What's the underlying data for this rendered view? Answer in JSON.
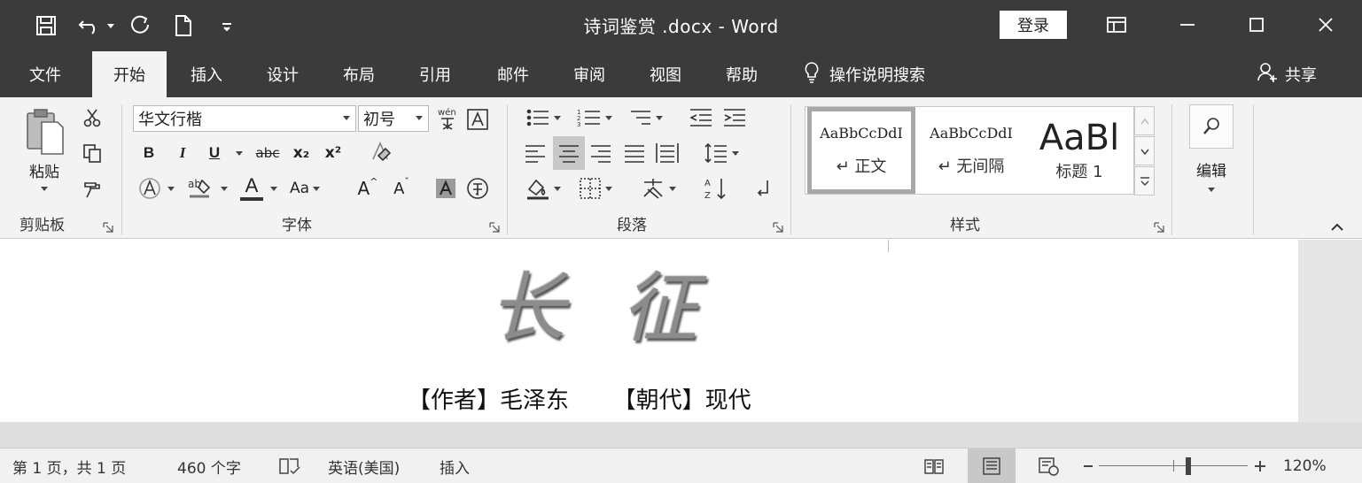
{
  "titlebar": {
    "title": "诗词鉴赏 .docx  -  Word",
    "login_label": "登录",
    "qat_icons": [
      "save-icon",
      "undo-icon",
      "redo-icon",
      "new-document-icon",
      "customize-qat-icon"
    ]
  },
  "tabs": [
    {
      "label": "文件",
      "active": false
    },
    {
      "label": "开始",
      "active": true
    },
    {
      "label": "插入",
      "active": false
    },
    {
      "label": "设计",
      "active": false
    },
    {
      "label": "布局",
      "active": false
    },
    {
      "label": "引用",
      "active": false
    },
    {
      "label": "邮件",
      "active": false
    },
    {
      "label": "审阅",
      "active": false
    },
    {
      "label": "视图",
      "active": false
    },
    {
      "label": "帮助",
      "active": false
    }
  ],
  "tell_me": "操作说明搜索",
  "share": "共享",
  "ribbon": {
    "clipboard": {
      "paste_label": "粘贴",
      "group_label": "剪贴板"
    },
    "font": {
      "font_name": "华文行楷",
      "font_size": "初号",
      "bold": "B",
      "italic": "I",
      "underline": "U",
      "strike": "abc",
      "subscript": "x₂",
      "superscript": "x²",
      "font_color": "A",
      "change_case": "Aa",
      "grow": "A",
      "shrink": "A",
      "group_label": "字体"
    },
    "paragraph": {
      "group_label": "段落"
    },
    "styles": {
      "items": [
        {
          "sample": "AaBbCcDdI",
          "name": "↵ 正文",
          "selected": true
        },
        {
          "sample": "AaBbCcDdI",
          "name": "↵ 无间隔",
          "selected": false
        },
        {
          "sample": "AaBl",
          "name": "标题 1",
          "selected": false
        }
      ],
      "group_label": "样式"
    },
    "editing": {
      "label": "编辑"
    }
  },
  "document": {
    "title": "长 征",
    "author_line": "【作者】毛泽东      【朝代】现代"
  },
  "statusbar": {
    "page": "第 1 页，共 1 页",
    "words": "460 个字",
    "language": "英语(美国)",
    "mode": "插入",
    "zoom_percent": "120%",
    "zoom_level": 0.6
  },
  "colors": {
    "titlebar_bg": "#3b3b3b",
    "ribbon_bg": "#f3f3f3",
    "active_tab_bg": "#f3f3f3"
  }
}
